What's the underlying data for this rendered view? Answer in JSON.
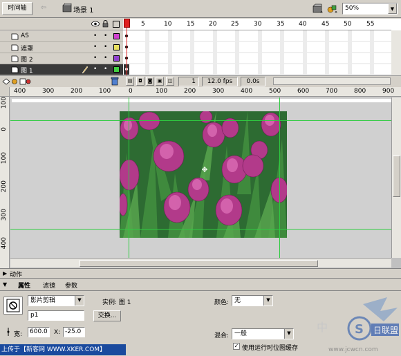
{
  "topbar": {
    "timeline_tab": "时间轴",
    "scene_label": "场景 1",
    "zoom_value": "50%"
  },
  "timeline": {
    "layers": [
      {
        "name": "AS",
        "color": "#d040d0",
        "selected": false
      },
      {
        "name": "遮罩",
        "color": "#e8e060",
        "selected": false
      },
      {
        "name": "图 2",
        "color": "#9040d0",
        "selected": false
      },
      {
        "name": "图 1",
        "color": "#40d040",
        "selected": true
      }
    ],
    "frame_numbers": [
      "5",
      "10",
      "15",
      "20",
      "25",
      "30",
      "35",
      "40",
      "45",
      "50",
      "55"
    ],
    "current_frame": "1",
    "fps": "12.0 fps",
    "elapsed": "0.0s"
  },
  "stage": {
    "hruler_labels": [
      "400",
      "300",
      "200",
      "100",
      "0",
      "100",
      "200",
      "300",
      "400",
      "500",
      "600",
      "700",
      "800",
      "900"
    ],
    "vruler_labels": [
      "100",
      "0",
      "100",
      "200",
      "300",
      "400"
    ]
  },
  "panels": {
    "actions_label": "动作",
    "tabs": [
      "属性",
      "滤镜",
      "参数"
    ]
  },
  "properties": {
    "symbol_type": "影片剪辑",
    "instance_label": "实例:  图 1",
    "instance_name": "p1",
    "swap_button": "交换...",
    "color_label": "颜色:",
    "color_value": "无",
    "width_label": "宽:",
    "width_value": "600.0",
    "x_label": "X:",
    "x_value": "-25.0",
    "blend_label": "混合:",
    "blend_value": "一般",
    "cache_checked": true,
    "cache_label": "使用运行时位图缓存"
  },
  "footer": {
    "upload_text": "上传于【新客网 WWW.XKER.COM】",
    "watermark_text": "中"
  }
}
